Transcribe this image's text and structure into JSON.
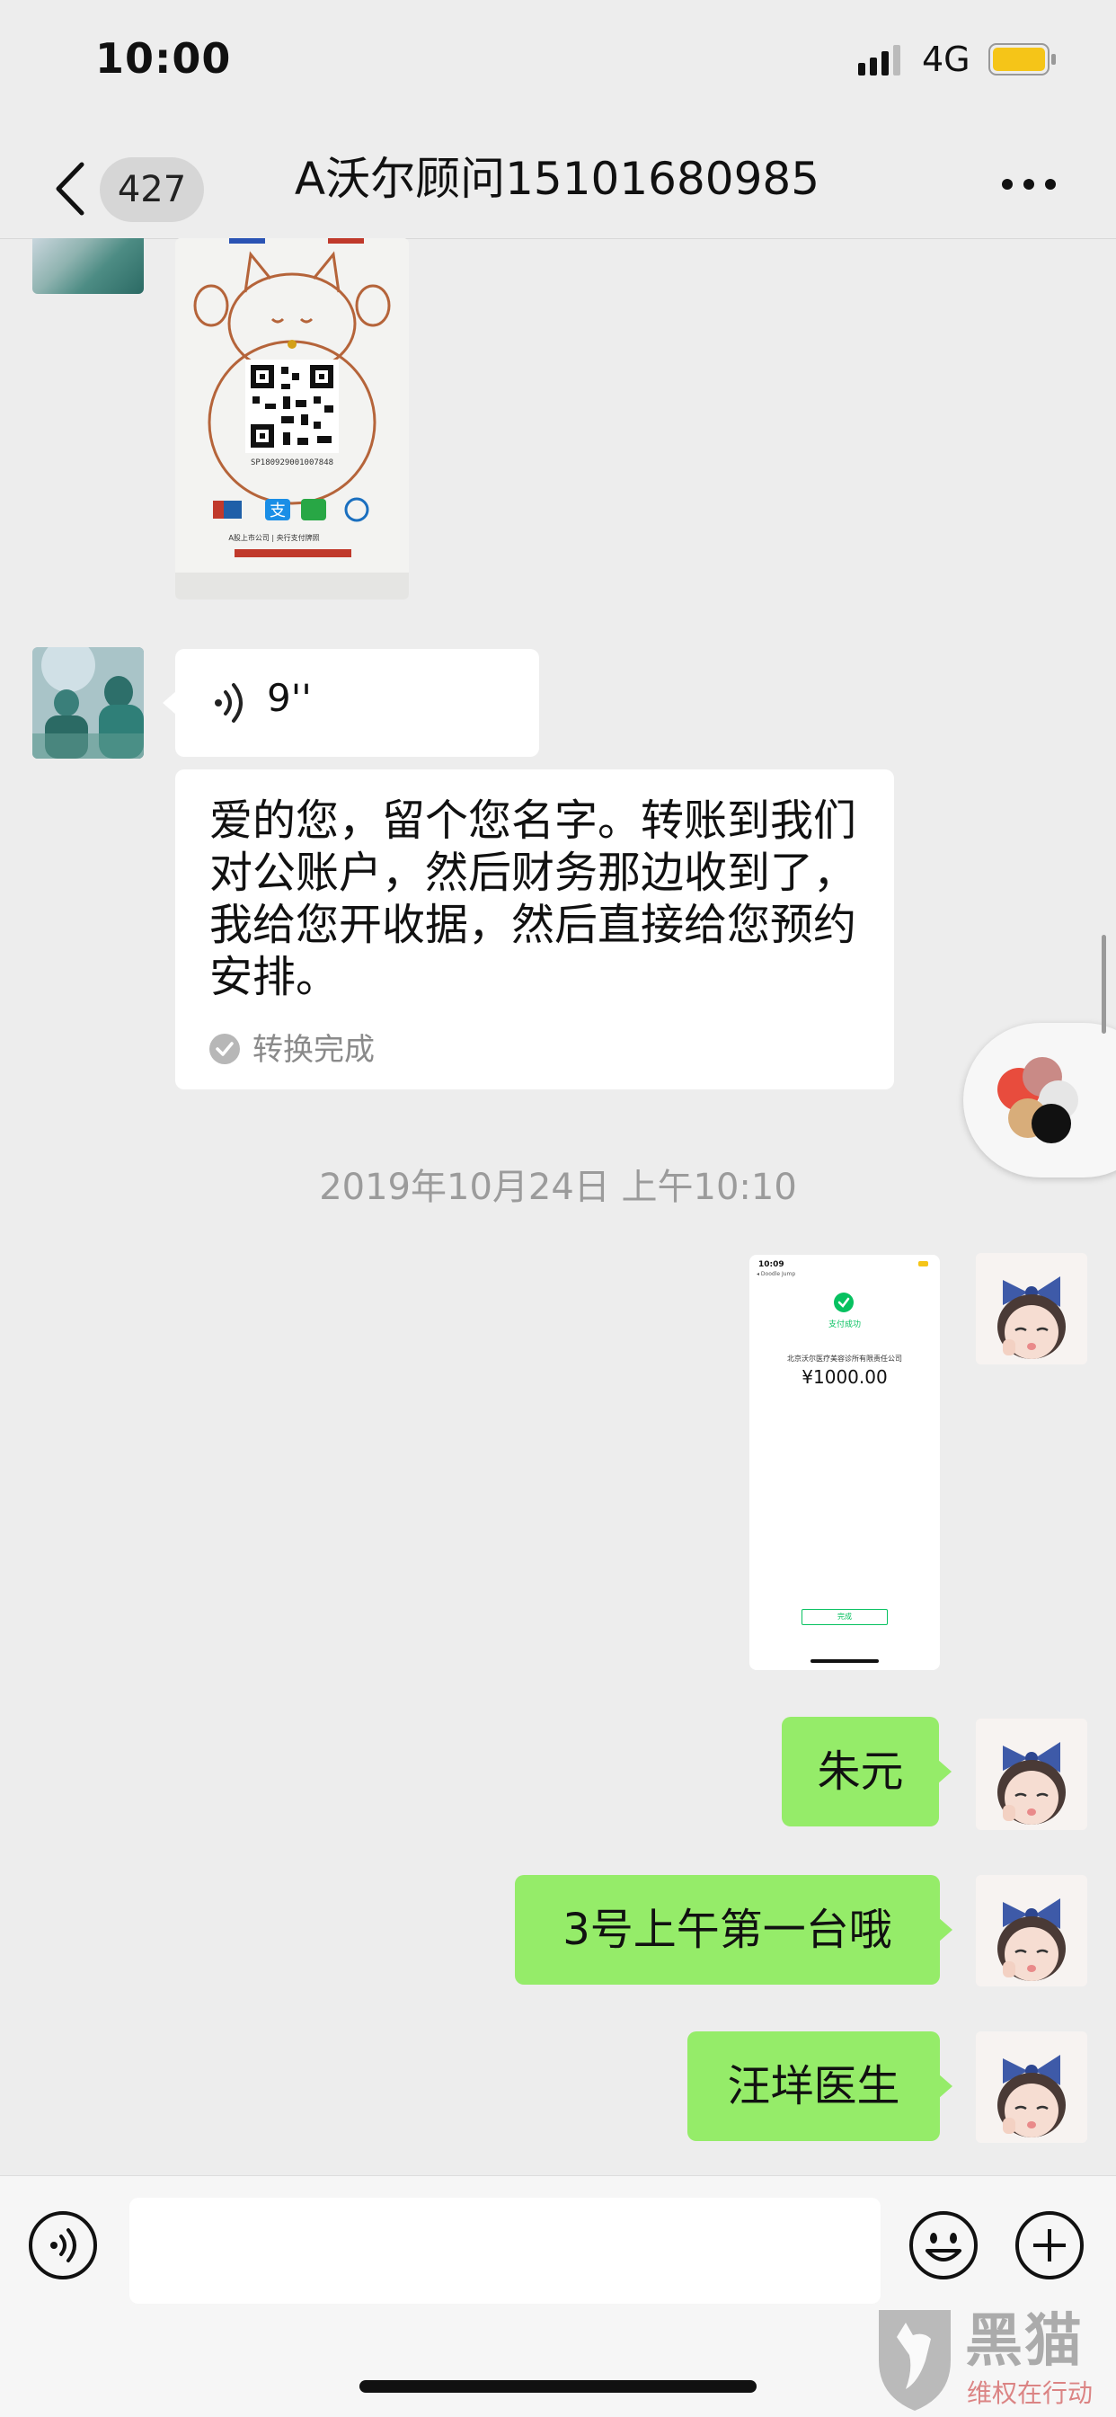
{
  "status_bar": {
    "time": "10:00",
    "network": "4G"
  },
  "nav": {
    "unread_count": "427",
    "title": "A沃尔顾问15101680985"
  },
  "messages": {
    "voice_duration": "9''",
    "transcript": "爱的您，留个您名字。转账到我们对公账户，然后财务那边收到了，我给您开收据，然后直接给您预约安排。",
    "transcript_status": "转换完成",
    "timestamp": "2019年10月24日 上午10:10",
    "sent_name": "朱元",
    "sent_surgery": "3号上午第一台哦",
    "sent_doctor": "汪垟医生"
  },
  "payment_screenshot": {
    "time": "10:09",
    "app": "◂ Doodle Jump",
    "status": "支付成功",
    "company": "北京沃尔医疗美容诊所有限责任公司",
    "amount": "¥1000.00",
    "done": "完成"
  },
  "qr_poster": {
    "code_number": "SP180929001007848",
    "brand_line": "A股上市公司  |  央行支付牌照"
  },
  "input": {
    "placeholder": ""
  },
  "watermark": {
    "brand": "黑猫",
    "slogan": "维权在行动"
  },
  "colors": {
    "bubble_green": "#95ec69",
    "background": "#ededed",
    "wechat_green": "#07c160"
  },
  "icons": [
    "signal-icon",
    "battery-icon",
    "back-chevron-icon",
    "more-icon",
    "voice-icon",
    "check-icon",
    "voice-toggle-icon",
    "emoji-icon",
    "plus-icon"
  ]
}
